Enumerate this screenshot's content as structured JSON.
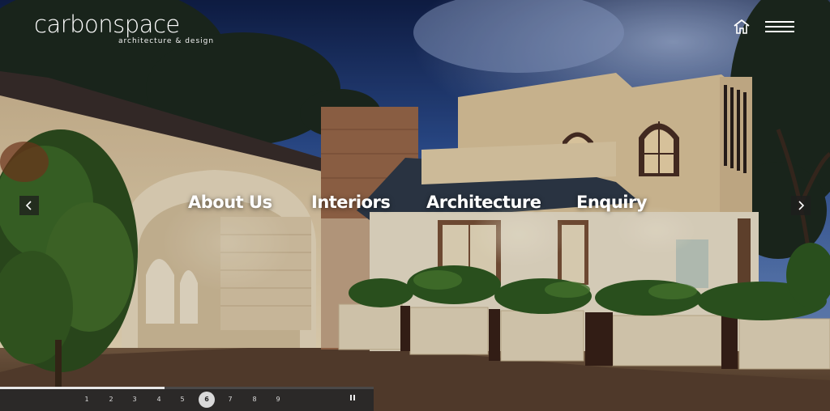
{
  "brand": {
    "name": "carbonspace",
    "tagline": "architecture & design"
  },
  "header": {
    "home_icon": "home-icon",
    "menu_icon": "hamburger-menu-icon"
  },
  "nav": {
    "items": [
      {
        "label": "About Us"
      },
      {
        "label": "Interiors"
      },
      {
        "label": "Architecture"
      },
      {
        "label": "Enquiry"
      }
    ]
  },
  "slider": {
    "prev_icon": "chevron-left-icon",
    "next_icon": "chevron-right-icon",
    "pages": [
      "1",
      "2",
      "3",
      "4",
      "5",
      "6",
      "7",
      "8",
      "9"
    ],
    "active_page": "6",
    "progress": 0.44,
    "pause_icon": "pause-icon"
  },
  "colors": {
    "sky": "#2c4a8a",
    "wall": "#e8d2a8",
    "foliage": "#3f6a2a",
    "pager_bg": "#282828"
  }
}
